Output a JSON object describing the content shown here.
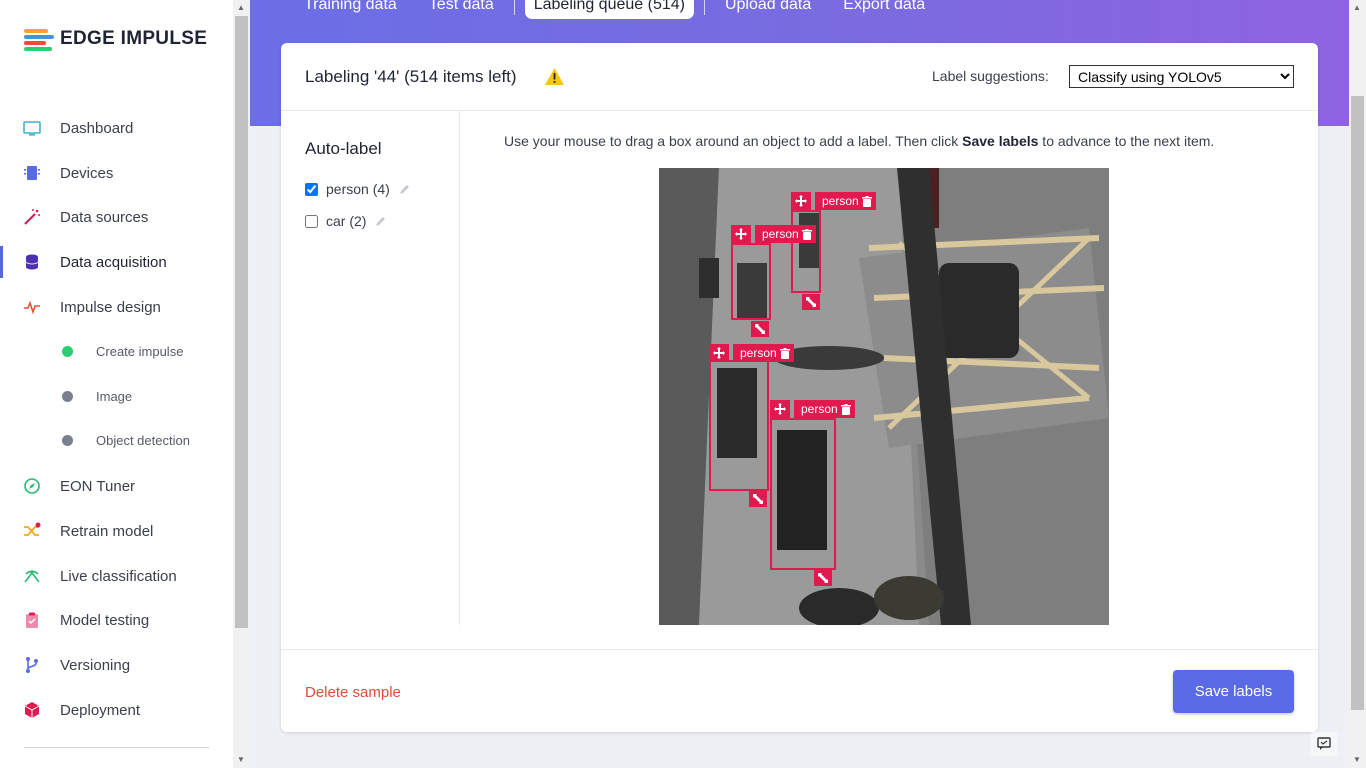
{
  "brand": {
    "name": "EDGE IMPULSE"
  },
  "sidebar": {
    "items": [
      {
        "label": "Dashboard"
      },
      {
        "label": "Devices"
      },
      {
        "label": "Data sources"
      },
      {
        "label": "Data acquisition"
      },
      {
        "label": "Impulse design"
      },
      {
        "label": "Create impulse"
      },
      {
        "label": "Image"
      },
      {
        "label": "Object detection"
      },
      {
        "label": "EON Tuner"
      },
      {
        "label": "Retrain model"
      },
      {
        "label": "Live classification"
      },
      {
        "label": "Model testing"
      },
      {
        "label": "Versioning"
      },
      {
        "label": "Deployment"
      }
    ]
  },
  "tabs": [
    {
      "label": "Training data"
    },
    {
      "label": "Test data"
    },
    {
      "label": "Labeling queue (514)"
    },
    {
      "label": "Upload data"
    },
    {
      "label": "Export data"
    }
  ],
  "card": {
    "title": "Labeling '44' (514 items left)",
    "suggestions_label": "Label suggestions:",
    "suggestions_value": "Classify using YOLOv5"
  },
  "autolabel": {
    "title": "Auto-label",
    "labels": [
      {
        "text": "person (4)",
        "checked": true
      },
      {
        "text": "car (2)",
        "checked": false
      }
    ]
  },
  "instructions": {
    "part1": "Use your mouse to drag a box around an object to add a label. Then click ",
    "bold": "Save labels",
    "part2": " to advance to the next item."
  },
  "boxes": [
    {
      "label": "person"
    },
    {
      "label": "person"
    },
    {
      "label": "person"
    },
    {
      "label": "person"
    }
  ],
  "footer": {
    "delete_label": "Delete sample",
    "save_label": "Save labels"
  },
  "colors": {
    "accent": "#5a6ae4",
    "box": "#e0194f",
    "delete": "#e34b36",
    "warning": "#f5c518"
  }
}
